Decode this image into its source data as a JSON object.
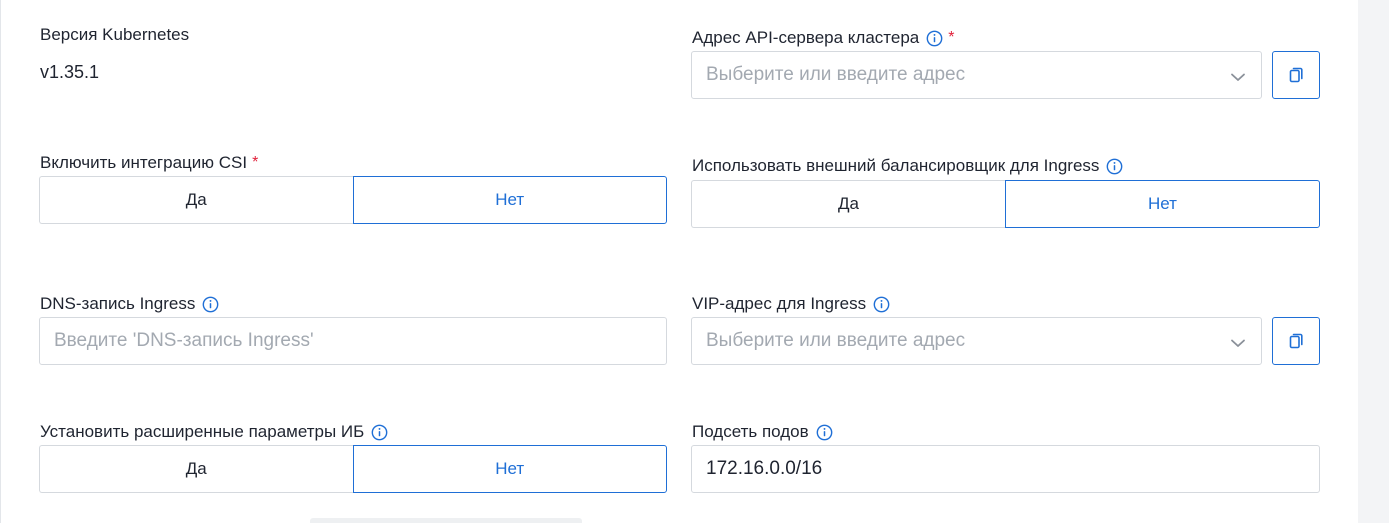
{
  "k8s_version": {
    "label": "Версия Kubernetes",
    "value": "v1.35.1"
  },
  "api_server": {
    "label": "Адрес API-сервера кластера",
    "required_mark": "*",
    "placeholder": "Выберите или введите адрес"
  },
  "csi": {
    "label": "Включить интеграцию CSI",
    "required_mark": "*",
    "options": [
      "Да",
      "Нет"
    ],
    "selected": "Нет"
  },
  "ext_balancer": {
    "label": "Использовать внешний балансировщик для Ingress",
    "options": [
      "Да",
      "Нет"
    ],
    "selected": "Нет"
  },
  "dns_ingress": {
    "label": "DNS-запись Ingress",
    "placeholder": "Введите 'DNS-запись Ingress'"
  },
  "vip_ingress": {
    "label": "VIP-адрес для Ingress",
    "placeholder": "Выберите или введите адрес"
  },
  "security": {
    "label": "Установить расширенные параметры ИБ",
    "options": [
      "Да",
      "Нет"
    ],
    "selected": "Нет"
  },
  "pod_subnet": {
    "label": "Подсеть подов",
    "value": "172.16.0.0/16"
  },
  "colors": {
    "accent": "#1f6fd6",
    "required": "#e0203a",
    "border": "#d5d9de",
    "placeholder": "#a3a9b1"
  }
}
